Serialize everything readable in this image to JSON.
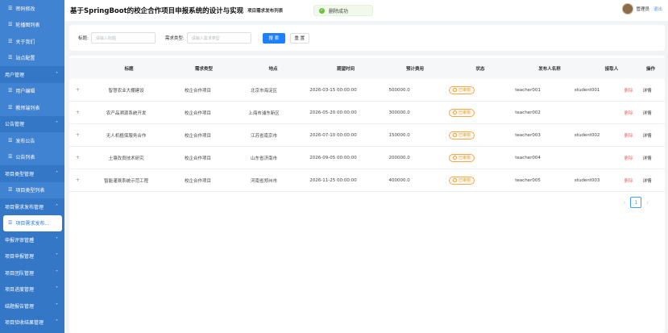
{
  "sidebar": {
    "items": [
      {
        "label": "密码修改",
        "type": "child"
      },
      {
        "label": "轮播图列表",
        "type": "child"
      },
      {
        "label": "关于我们",
        "type": "child"
      },
      {
        "label": "站点配置",
        "type": "child"
      },
      {
        "label": "用户管理",
        "type": "group",
        "chevron": "˄"
      },
      {
        "label": "用户编辑",
        "type": "child"
      },
      {
        "label": "教师端列表",
        "type": "child"
      },
      {
        "label": "公告管理",
        "type": "group",
        "chevron": "˄"
      },
      {
        "label": "发布公告",
        "type": "child"
      },
      {
        "label": "公告列表",
        "type": "child"
      },
      {
        "label": "项目类型管理",
        "type": "group",
        "chevron": "˄"
      },
      {
        "label": "项目类型列表",
        "type": "child"
      },
      {
        "label": "项目需求发布管理",
        "type": "group",
        "chevron": "˄"
      },
      {
        "label": "项目需求发布...",
        "type": "active"
      },
      {
        "label": "申报评审管理",
        "type": "group",
        "chevron": "˅"
      },
      {
        "label": "项目申报管理",
        "type": "group",
        "chevron": "˅"
      },
      {
        "label": "项目团队管理",
        "type": "group",
        "chevron": "˅"
      },
      {
        "label": "项目进度管理",
        "type": "group",
        "chevron": "˅"
      },
      {
        "label": "结题报告管理",
        "type": "group",
        "chevron": "˅"
      },
      {
        "label": "项目验收结果管理",
        "type": "group",
        "chevron": "˅"
      }
    ]
  },
  "header": {
    "title": "基于SpringBoot的校企合作项目申报系统的设计与实现",
    "breadcrumb": "项目需求发布列表",
    "toast": "删除成功",
    "user": "管理员",
    "logout": "退出"
  },
  "search": {
    "title_label": "标题:",
    "title_placeholder": "请输入标题",
    "type_label": "需求类型:",
    "type_placeholder": "请输入需求类型",
    "search_btn": "搜 索",
    "reset_btn": "重 置"
  },
  "table": {
    "columns": [
      "",
      "标题",
      "需求类型",
      "地点",
      "期望时间",
      "预计费用",
      "状态",
      "发布人名称",
      "接取人",
      "操作"
    ],
    "rows": [
      {
        "expand": "+",
        "title": "智慧农业大棚建设",
        "type": "校企合作项目",
        "place": "北京市海淀区",
        "time": "2026-03-15 00:00:00",
        "cost": "500000.0",
        "status": "已审核",
        "publisher": "teacher001",
        "taker": "student001",
        "del": "删除",
        "detail": "详情"
      },
      {
        "expand": "+",
        "title": "农产品溯源系统开发",
        "type": "校企合作项目",
        "place": "上海市浦东新区",
        "time": "2026-05-20 00:00:00",
        "cost": "300000.0",
        "status": "已审核",
        "publisher": "teacher002",
        "taker": "",
        "del": "删除",
        "detail": "详情"
      },
      {
        "expand": "+",
        "title": "无人机植保服务合作",
        "type": "校企合作项目",
        "place": "江苏省南京市",
        "time": "2026-07-10 00:00:00",
        "cost": "150000.0",
        "status": "已审核",
        "publisher": "teacher003",
        "taker": "student002",
        "del": "删除",
        "detail": "详情"
      },
      {
        "expand": "+",
        "title": "土壤改良技术研究",
        "type": "校企合作项目",
        "place": "山东省济南市",
        "time": "2026-09-05 00:00:00",
        "cost": "200000.0",
        "status": "已审核",
        "publisher": "teacher004",
        "taker": "",
        "del": "删除",
        "detail": "详情"
      },
      {
        "expand": "+",
        "title": "智能灌溉系统示范工程",
        "type": "校企合作项目",
        "place": "河南省郑州市",
        "time": "2026-11-25 00:00:00",
        "cost": "400000.0",
        "status": "已审核",
        "publisher": "teacher005",
        "taker": "student003",
        "del": "删除",
        "detail": "详情"
      }
    ]
  },
  "pager": {
    "prev": "‹",
    "page": "1",
    "next": "›"
  },
  "colors": {
    "sidebar": "#3477c7",
    "primary": "#1e80ff",
    "warning": "#e6a23c",
    "danger": "#f56c6c",
    "success": "#67c23a"
  }
}
